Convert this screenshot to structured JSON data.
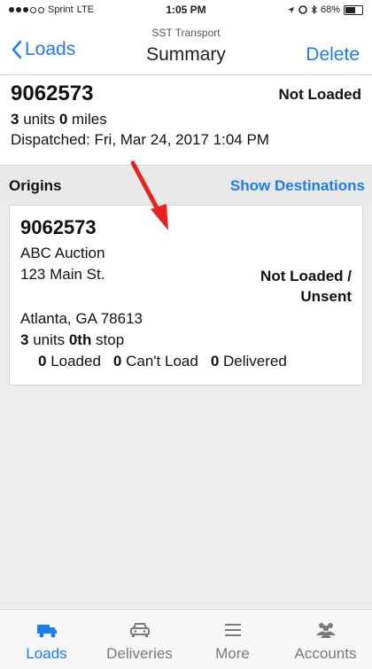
{
  "status_bar": {
    "carrier": "Sprint",
    "network": "LTE",
    "time": "1:05 PM",
    "battery": "68%",
    "battery_level": 0.68
  },
  "nav": {
    "back_label": "Loads",
    "subtitle": "SST Transport",
    "title": "Summary",
    "delete_label": "Delete"
  },
  "summary": {
    "load_id": "9062573",
    "status": "Not Loaded",
    "units_value": "3",
    "units_label": " units ",
    "miles_value": "0",
    "miles_label": " miles",
    "dispatched": "Dispatched: Fri, Mar 24, 2017 1:04 PM"
  },
  "origins": {
    "header": "Origins",
    "show_destinations": "Show Destinations",
    "card": {
      "id": "9062573",
      "name": "ABC Auction",
      "street": "123 Main St.",
      "status_line1": "Not Loaded /",
      "status_line2": "Unsent",
      "city": "Atlanta, GA 78613",
      "units_value": "3",
      "units_label": " units ",
      "stop_value": "0th",
      "stop_label": " stop",
      "loaded_value": "0",
      "loaded_label": " Loaded",
      "cant_load_value": "0",
      "cant_load_label": " Can't Load",
      "delivered_value": "0",
      "delivered_label": " Delivered"
    }
  },
  "tabs": [
    {
      "label": "Loads",
      "icon": "truck-icon",
      "active": true
    },
    {
      "label": "Deliveries",
      "icon": "car-icon",
      "active": false
    },
    {
      "label": "More",
      "icon": "menu-icon",
      "active": false
    },
    {
      "label": "Accounts",
      "icon": "people-icon",
      "active": false
    }
  ],
  "colors": {
    "accent": "#1e7cf2",
    "annotation": "#e8231f",
    "inactive_tab": "#7a7a7a"
  }
}
